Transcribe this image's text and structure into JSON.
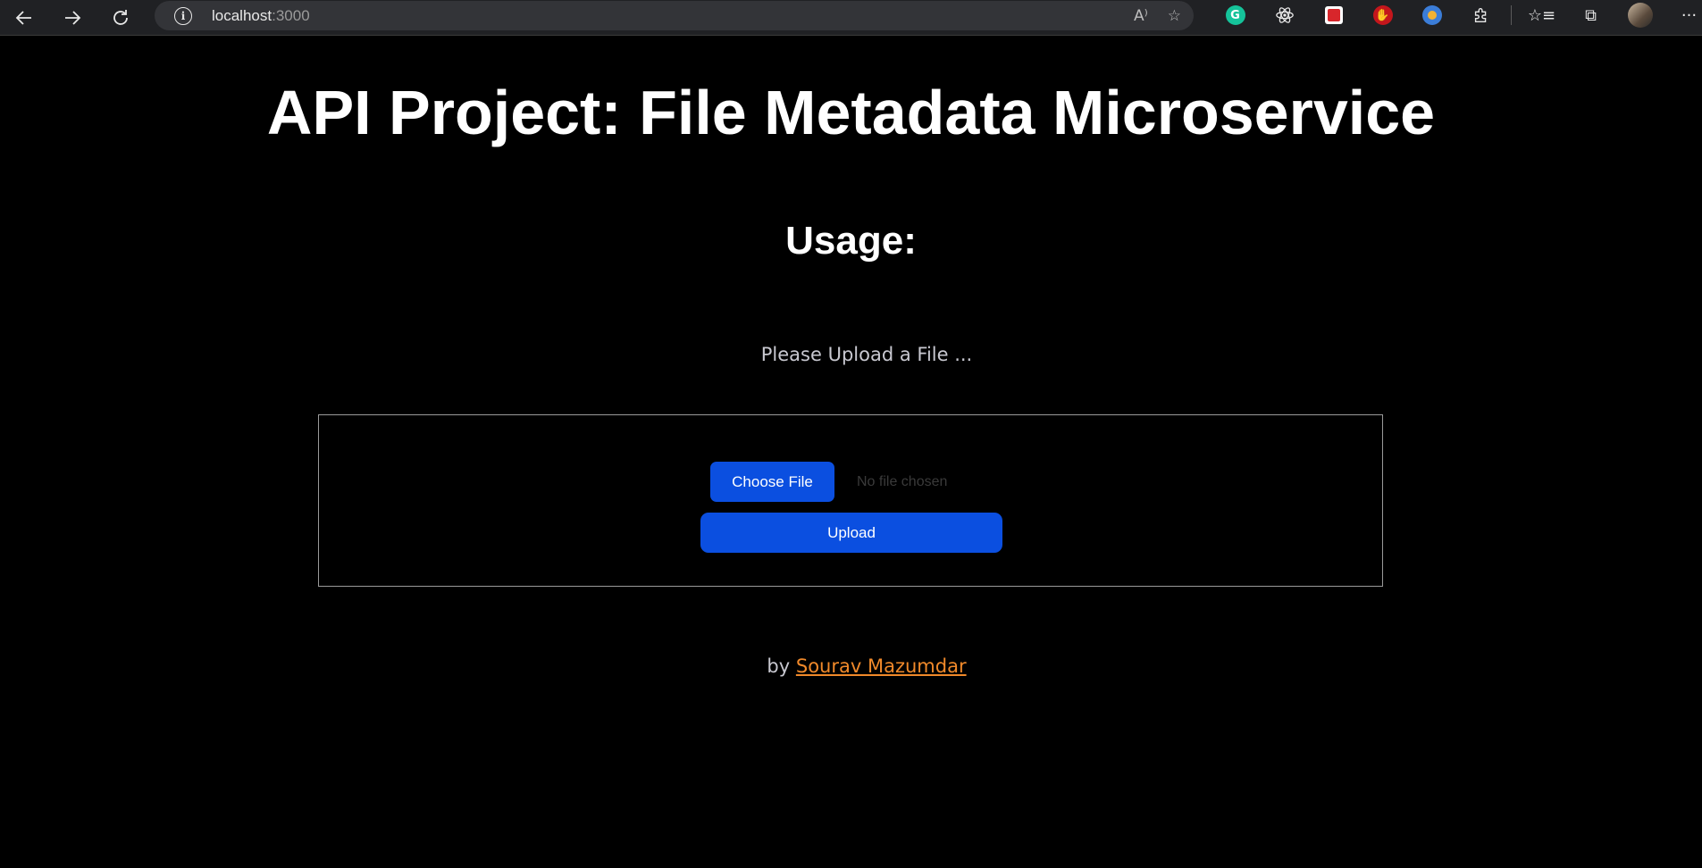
{
  "browser": {
    "url_host": "localhost",
    "url_port": ":3000"
  },
  "page": {
    "title": "API Project: File Metadata Microservice",
    "usage_heading": "Usage:",
    "upload_prompt": "Please Upload a File ...",
    "file_input": {
      "button_label": "Choose File",
      "status_text": "No file chosen"
    },
    "upload_button_label": "Upload",
    "footer": {
      "prefix": "by",
      "author_link": "Sourav Mazumdar"
    }
  },
  "colors": {
    "background": "#000000",
    "button_blue": "#0b4fe0",
    "link_orange": "#f0892a"
  },
  "icons": [
    "back-arrow-icon",
    "forward-arrow-icon",
    "refresh-icon",
    "info-icon",
    "read-aloud-icon",
    "add-favorite-icon",
    "grammarly-icon",
    "react-devtools-icon",
    "extension-red-icon",
    "extension-hand-icon",
    "extension-globe-icon",
    "extensions-puzzle-icon",
    "favorites-icon",
    "collections-icon",
    "profile-avatar",
    "more-menu-icon"
  ]
}
